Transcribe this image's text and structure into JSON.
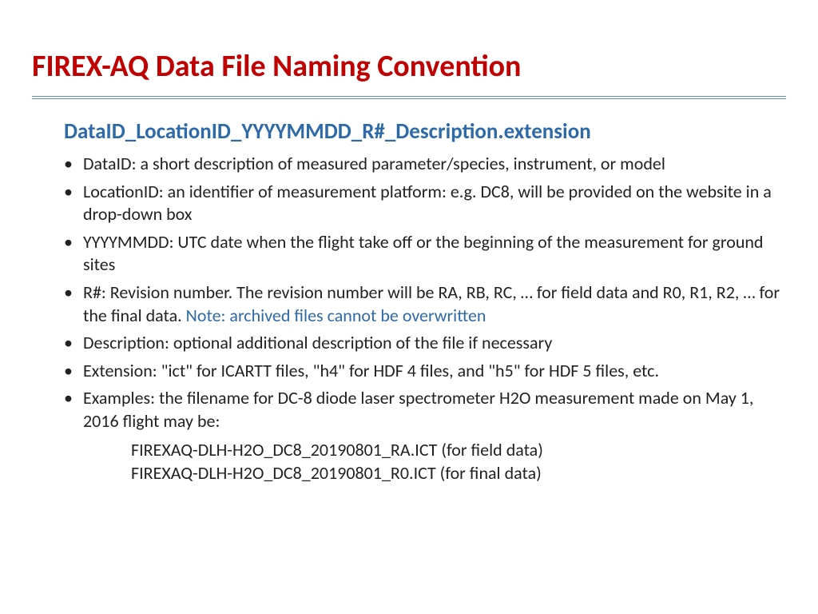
{
  "title": "FIREX-AQ Data File Naming Convention",
  "format": "DataID_LocationID_YYYYMMDD_R#_Description.extension",
  "bullets": {
    "b0": "DataID: a short description of measured parameter/species, instrument, or model",
    "b1": "LocationID: an identifier of measurement platform: e.g. DC8, will be provided on the website in a drop-down box",
    "b2": "YYYYMMDD: UTC date when the flight take off or the beginning of the measurement for ground sites",
    "b3_main": "R#: Revision number. The revision number will be RA, RB, RC, … for field data and R0, R1, R2, … for the final data.  ",
    "b3_note": "Note: archived files cannot be overwritten",
    "b4": "Description: optional additional description of the file if necessary",
    "b5": "Extension: \"ict\" for ICARTT files, \"h4\" for HDF 4 files, and \"h5\" for HDF 5 files, etc.",
    "b6": "Examples: the filename for DC-8 diode laser spectrometer H2O measurement made on May 1, 2016 flight may be:"
  },
  "examples": {
    "e0": "FIREXAQ-DLH-H2O_DC8_20190801_RA.ICT (for field data)",
    "e1": "FIREXAQ-DLH-H2O_DC8_20190801_R0.ICT (for final data)"
  }
}
